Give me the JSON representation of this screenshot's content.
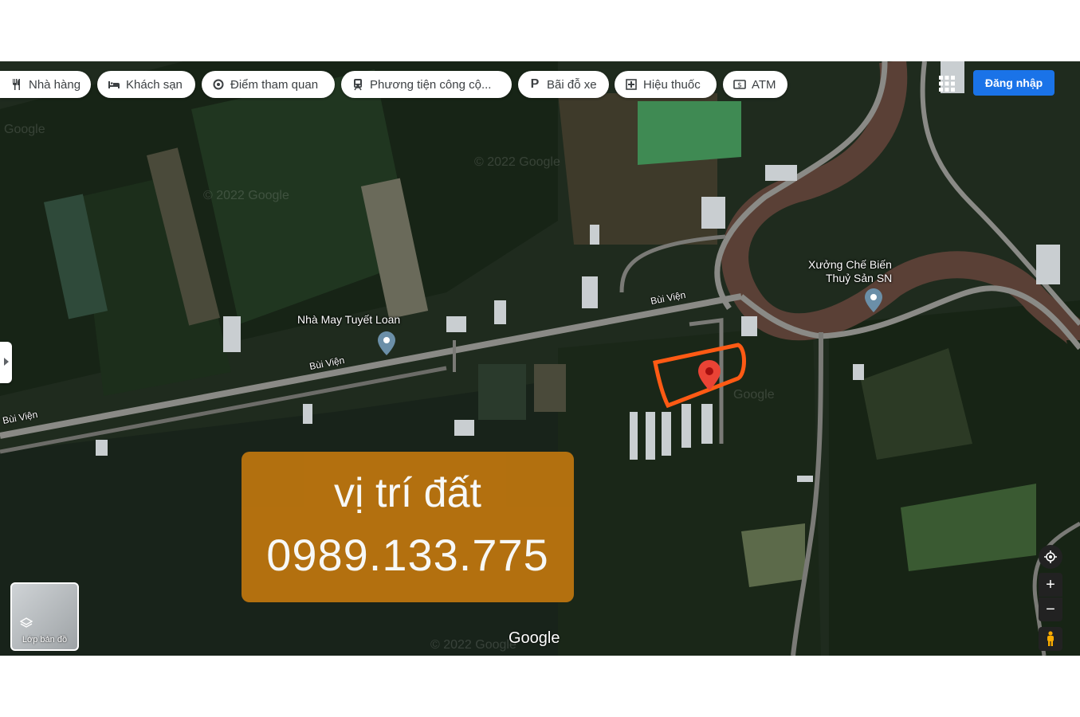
{
  "filters": [
    {
      "label": "Nhà hàng",
      "icon": "fork-knife-icon"
    },
    {
      "label": "Khách sạn",
      "icon": "bed-icon"
    },
    {
      "label": "Điểm tham quan",
      "icon": "camera-icon"
    },
    {
      "label": "Phương tiện công cộ...",
      "icon": "train-icon"
    },
    {
      "label": "Bãi đỗ xe",
      "icon": "parking-icon"
    },
    {
      "label": "Hiệu thuốc",
      "icon": "pharmacy-icon"
    },
    {
      "label": "ATM",
      "icon": "atm-icon"
    }
  ],
  "header": {
    "signin_label": "Đăng nhập"
  },
  "places": {
    "factory_label": "Nhà May Tuyết Loan",
    "seafood_label_1": "Xưởng Chế Biến",
    "seafood_label_2": "Thuỷ Sản SN"
  },
  "roads": {
    "road_1": "Bùi Viện",
    "road_2": "Bùi Viện",
    "road_3": "Bùi Viện"
  },
  "watermarks": [
    "Google",
    "© 2022 Google",
    "© 2022 Google",
    "Google",
    "© 2022 Google"
  ],
  "overlay": {
    "line1": "vị trí đất",
    "line2": "0989.133.775"
  },
  "layers": {
    "label": "Lớp bản đồ"
  },
  "brand": {
    "logo": "Google"
  },
  "controls": {
    "zoom_in": "+",
    "zoom_out": "−"
  },
  "colors": {
    "accent": "#1a73e8",
    "overlay": "#b8730f",
    "outline": "#ff5a14",
    "pin": "#ea4335"
  }
}
